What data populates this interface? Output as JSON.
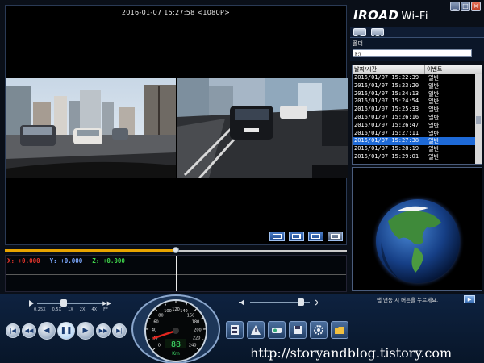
{
  "app": {
    "logo_main": "IROAD",
    "logo_sub": "Wi-Fi",
    "window_buttons": [
      "_",
      "□",
      "×"
    ]
  },
  "video": {
    "timestamp": "2016-01-07 15:27:58 <1080P>",
    "views": [
      "front-camera",
      "rear-camera"
    ],
    "layout_buttons": [
      "layout-single",
      "layout-split",
      "layout-pip",
      "layout-full"
    ],
    "progress_fraction": 0.5
  },
  "gsensor": {
    "x_label": "X: +0.000",
    "y_label": "Y: +0.000",
    "z_label": "Z: +0.000",
    "colors": {
      "x": "#e0342a",
      "y": "#7da9ff",
      "z": "#3fd34a"
    }
  },
  "playback": {
    "speed_labels": [
      "0.25X",
      "0.5X",
      "1X",
      "2X",
      "4X",
      "FF"
    ],
    "speed_fraction": 0.4,
    "volume_fraction": 0.85,
    "buttons": [
      "first-icon",
      "prev-icon",
      "rewind-icon",
      "pause-icon",
      "play-icon",
      "next-icon",
      "last-icon",
      "loop-icon"
    ]
  },
  "speedometer": {
    "ticks": [
      "0",
      "20",
      "40",
      "60",
      "80",
      "100",
      "120",
      "140",
      "160",
      "180",
      "200",
      "220",
      "240"
    ],
    "digital": "88",
    "unit": "Km",
    "needle_value": 20,
    "max_value": 240
  },
  "tools": [
    "film-icon",
    "warning-icon",
    "settings-icon",
    "save-icon",
    "gear-icon",
    "folder-icon"
  ],
  "folder": {
    "label": "폴더",
    "path": "F:\\"
  },
  "list": {
    "headers": {
      "datetime": "날짜/시간",
      "event": "이벤트"
    },
    "rows": [
      {
        "datetime": "2016/01/07 15:22:39",
        "event": "일반"
      },
      {
        "datetime": "2016/01/07 15:23:20",
        "event": "일반"
      },
      {
        "datetime": "2016/01/07 15:24:13",
        "event": "일반"
      },
      {
        "datetime": "2016/01/07 15:24:54",
        "event": "일반"
      },
      {
        "datetime": "2016/01/07 15:25:33",
        "event": "일반"
      },
      {
        "datetime": "2016/01/07 15:26:16",
        "event": "일반"
      },
      {
        "datetime": "2016/01/07 15:26:47",
        "event": "일반"
      },
      {
        "datetime": "2016/01/07 15:27:11",
        "event": "일반"
      },
      {
        "datetime": "2016/01/07 15:27:38",
        "event": "일반"
      },
      {
        "datetime": "2016/01/07 15:28:19",
        "event": "일반"
      },
      {
        "datetime": "2016/01/07 15:29:01",
        "event": "일반"
      }
    ],
    "selected_index": 8
  },
  "wifi": {
    "message": "랩 연동 시 버튼을 누르세요.",
    "button": "▶"
  },
  "watermark": "http://storyandblog.tistory.com"
}
